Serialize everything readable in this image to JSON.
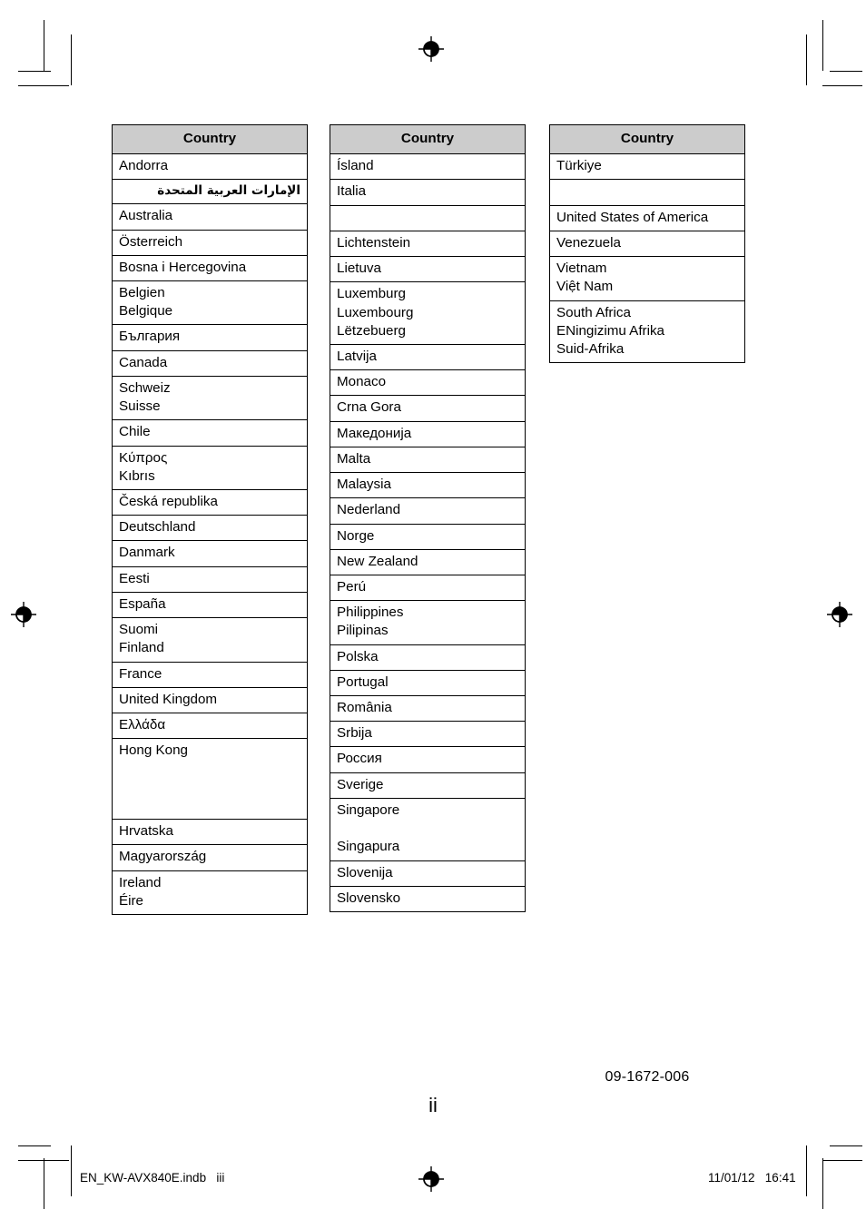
{
  "page": {
    "page_number": "ii",
    "part_number": "09-1672-006"
  },
  "footer": {
    "left": "EN_KW-AVX840E.indb   iii",
    "right": "11/01/12   16:41"
  },
  "colors": {
    "header_background": "#cccccc",
    "border": "#000000",
    "text": "#000000",
    "page_background": "#ffffff"
  },
  "icons": {
    "registration_target": "registration-target-icon",
    "crop_mark": "crop-mark-icon"
  },
  "tables": [
    {
      "id": "table-1",
      "header": "Country",
      "rows": [
        {
          "lines": [
            "Andorra"
          ],
          "thick_bottom": true
        },
        {
          "lines": [
            "الإمارات العربية المتحدة"
          ],
          "rtl": true,
          "thick_bottom": false
        },
        {
          "lines": [
            "Australia"
          ],
          "thick_bottom": false
        },
        {
          "lines": [
            "Österreich"
          ],
          "thick_bottom": false
        },
        {
          "lines": [
            "Bosna i Hercegovina"
          ],
          "thick_bottom": false
        },
        {
          "lines": [
            "Belgien",
            "Belgique"
          ],
          "thick_bottom": true
        },
        {
          "lines": [
            "България"
          ],
          "thick_bottom": false
        },
        {
          "lines": [
            "Canada"
          ],
          "thick_bottom": false
        },
        {
          "lines": [
            "Schweiz",
            "Suisse"
          ],
          "thick_bottom": false
        },
        {
          "lines": [
            "Chile"
          ],
          "thick_bottom": false
        },
        {
          "lines": [
            "Κύπρος",
            "Kıbrıs"
          ],
          "thick_bottom": false
        },
        {
          "lines": [
            "Česká republika"
          ],
          "thick_bottom": false
        },
        {
          "lines": [
            "Deutschland"
          ],
          "thick_bottom": false
        },
        {
          "lines": [
            "Danmark"
          ],
          "thick_bottom": false
        },
        {
          "lines": [
            "Eesti"
          ],
          "thick_bottom": false
        },
        {
          "lines": [
            "España"
          ],
          "thick_bottom": true
        },
        {
          "lines": [
            "Suomi",
            "Finland"
          ],
          "thick_bottom": false
        },
        {
          "lines": [
            "France"
          ],
          "thick_bottom": false
        },
        {
          "lines": [
            "United Kingdom"
          ],
          "thick_bottom": false
        },
        {
          "lines": [
            "Ελλάδα"
          ],
          "thick_bottom": false
        },
        {
          "lines": [
            "Hong Kong",
            "",
            "",
            ""
          ],
          "thick_bottom": false
        },
        {
          "lines": [
            "Hrvatska"
          ],
          "thick_bottom": false
        },
        {
          "lines": [
            "Magyarország"
          ],
          "thick_bottom": false
        },
        {
          "lines": [
            "Ireland",
            "Éire"
          ],
          "thick_bottom": false
        }
      ]
    },
    {
      "id": "table-2",
      "header": "Country",
      "rows": [
        {
          "lines": [
            "Ísland"
          ],
          "thick_bottom": true
        },
        {
          "lines": [
            "Italia"
          ],
          "thick_bottom": false
        },
        {
          "lines": [
            ""
          ],
          "thick_bottom": true
        },
        {
          "lines": [
            "Lichtenstein"
          ],
          "thick_bottom": false
        },
        {
          "lines": [
            "Lietuva"
          ],
          "thick_bottom": false
        },
        {
          "lines": [
            "Luxemburg",
            "Luxembourg",
            "Lëtzebuerg"
          ],
          "thick_bottom": false
        },
        {
          "lines": [
            "Latvija"
          ],
          "thick_bottom": true
        },
        {
          "lines": [
            "Monaco"
          ],
          "thick_bottom": false
        },
        {
          "lines": [
            "Crna Gora"
          ],
          "thick_bottom": false
        },
        {
          "lines": [
            "Македонија"
          ],
          "thick_bottom": false
        },
        {
          "lines": [
            "Malta"
          ],
          "thick_bottom": false
        },
        {
          "lines": [
            "Malaysia"
          ],
          "thick_bottom": false
        },
        {
          "lines": [
            "Nederland"
          ],
          "thick_bottom": true
        },
        {
          "lines": [
            "Norge"
          ],
          "thick_bottom": false
        },
        {
          "lines": [
            "New Zealand"
          ],
          "thick_bottom": false
        },
        {
          "lines": [
            "Perú"
          ],
          "thick_bottom": false
        },
        {
          "lines": [
            "Philippines",
            "Pilipinas"
          ],
          "thick_bottom": false
        },
        {
          "lines": [
            "Polska"
          ],
          "thick_bottom": true
        },
        {
          "lines": [
            "Portugal"
          ],
          "thick_bottom": false
        },
        {
          "lines": [
            "România"
          ],
          "thick_bottom": false
        },
        {
          "lines": [
            "Srbija"
          ],
          "thick_bottom": false
        },
        {
          "lines": [
            "Россия"
          ],
          "thick_bottom": false
        },
        {
          "lines": [
            "Sverige"
          ],
          "thick_bottom": false
        },
        {
          "lines": [
            "Singapore",
            "",
            "Singapura"
          ],
          "thick_bottom": false
        },
        {
          "lines": [
            "Slovenija"
          ],
          "thick_bottom": false
        },
        {
          "lines": [
            "Slovensko"
          ],
          "thick_bottom": false
        }
      ]
    },
    {
      "id": "table-3",
      "header": "Country",
      "rows": [
        {
          "lines": [
            "Türkiye"
          ],
          "thick_bottom": true
        },
        {
          "lines": [
            ""
          ],
          "thick_bottom": true
        },
        {
          "lines": [
            "United States of America"
          ],
          "thick_bottom": false
        },
        {
          "lines": [
            "Venezuela"
          ],
          "thick_bottom": false
        },
        {
          "lines": [
            "Vietnam",
            "Việt Nam"
          ],
          "thick_bottom": true
        },
        {
          "lines": [
            "South Africa",
            "ENingizimu Afrika",
            "Suid-Afrika"
          ],
          "thick_bottom": false
        }
      ]
    }
  ]
}
